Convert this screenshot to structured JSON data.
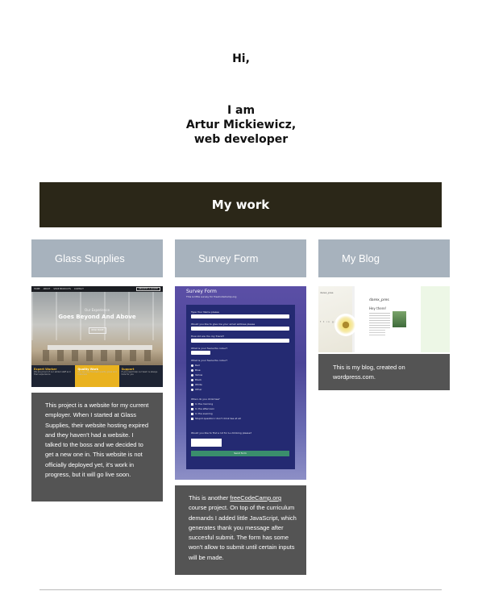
{
  "intro": {
    "greeting": "Hi,",
    "line1": "I am",
    "line2": "Artur Mickiewicz,",
    "line3": "web developer"
  },
  "section_title": "My work",
  "projects": [
    {
      "title": "Glass Supplies",
      "description": "This project is a website for my current employer. When I started at Glass Supplies, their website hosting expired and they haven't had a website. I talked to the boss and we decided to get a new one in. This website is not officially deployed yet, it's work in progress, but it will go live soon.",
      "thumb": {
        "nav_items": [
          "HOME",
          "ABOUT",
          "SHOP PRODUCTS",
          "CONTACT"
        ],
        "nav_cta": "REQUEST A QUOTE",
        "hero_sub": "Our Experience",
        "hero_title": "Goes Beyond And Above",
        "hero_button": "READ MORE",
        "features": [
          {
            "title": "Expert Worker",
            "text": "We are proud of our skilled staff and their experience"
          },
          {
            "title": "Quality Work",
            "text": "We use only the best quality glass and materials"
          },
          {
            "title": "Support",
            "text": "If you need help our team is always here for you"
          }
        ]
      }
    },
    {
      "title": "Survey Form",
      "description_before": "This is another ",
      "link_text": "freeCodeCamp.org",
      "description_after": " course project. On top of the curriculum demands I added little JavaScript, which generates thank you message after succesful submit. The form has some won't allow to submit until certain inputs will be made.",
      "thumb": {
        "title": "Survey Form",
        "subtitle": "This is little survey for freeCodeCamp.org",
        "label_name": "Type Your Name please",
        "ph_name": "Type your name please",
        "label_email": "Would you like to give me your email address please",
        "ph_email": "Type your email",
        "label_age": "How old are You my friend?",
        "ph_age": "Type your age",
        "label_color": "What is your favourite colour?",
        "label_animal": "What is your favourite colour?",
        "options": [
          "Red",
          "Blue",
          "Yellow",
          "Black",
          "White",
          "Other"
        ],
        "label_time": "When do you drink tea?",
        "checks": [
          "In the morning",
          "In the afternoon",
          "In the evening",
          "Stupid question I don't drink tea at all"
        ],
        "label_comment": "Would you like to find a lot for Lu drinking please?",
        "button": "Send form"
      }
    },
    {
      "title": "My Blog",
      "description": "This is my blog, created on wordpress.com.",
      "thumb": {
        "site_name": "darex_pres",
        "post_title": "Hey there!",
        "sidebar_name": "darex_pres",
        "icons": "f t in g+"
      }
    }
  ],
  "colors": {
    "banner": "#2b2718",
    "card_header": "#a7b2bd",
    "description_bg": "#545454"
  }
}
